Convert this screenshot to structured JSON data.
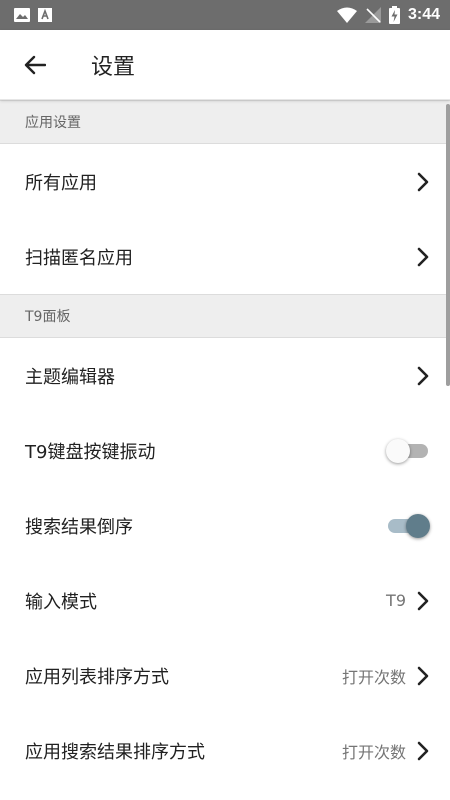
{
  "status_bar": {
    "time": "3:44",
    "icons_left": [
      "image-icon",
      "a-notification-icon"
    ],
    "icons_right": [
      "wifi-icon",
      "no-signal-icon",
      "battery-charging-icon"
    ]
  },
  "app_bar": {
    "title": "设置",
    "back_icon": "arrow-left-icon"
  },
  "sections": [
    {
      "header": "应用设置",
      "rows": [
        {
          "label": "所有应用",
          "type": "nav"
        },
        {
          "label": "扫描匿名应用",
          "type": "nav"
        }
      ]
    },
    {
      "header": "T9面板",
      "rows": [
        {
          "label": "主题编辑器",
          "type": "nav"
        },
        {
          "label": "T9键盘按键振动",
          "type": "switch",
          "checked": false
        },
        {
          "label": "搜索结果倒序",
          "type": "switch",
          "checked": true
        },
        {
          "label": "输入模式",
          "type": "nav",
          "value": "T9"
        },
        {
          "label": "应用列表排序方式",
          "type": "nav",
          "value": "打开次数"
        },
        {
          "label": "应用搜索结果排序方式",
          "type": "nav",
          "value": "打开次数"
        }
      ]
    }
  ],
  "colors": {
    "status_bar": "#6d6d6d",
    "section_bg": "#eeeeee",
    "switch_on_thumb": "#607d8b",
    "switch_on_track": "#a8bcc8"
  }
}
